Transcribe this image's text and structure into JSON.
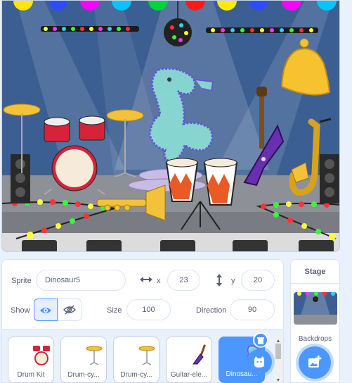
{
  "sprite_info": {
    "sprite_label": "Sprite",
    "sprite_name": "Dinosaur5",
    "x_label": "x",
    "x_value": "23",
    "y_label": "y",
    "y_value": "20",
    "show_label": "Show",
    "size_label": "Size",
    "size_value": "100",
    "direction_label": "Direction",
    "direction_value": "90"
  },
  "sprites": [
    {
      "name": "Drum Kit",
      "icon": "drum-kit-icon"
    },
    {
      "name": "Drum-cy...",
      "icon": "cymbal-icon"
    },
    {
      "name": "Drum-cy...",
      "icon": "cymbal-icon"
    },
    {
      "name": "Guitar-ele...",
      "icon": "electric-guitar-icon"
    },
    {
      "name": "Dinosau...",
      "icon": "dinosaur-icon",
      "selected": true
    }
  ],
  "stage_panel": {
    "title": "Stage",
    "backdrops_label": "Backdrops"
  },
  "colors": {
    "accent": "#4c97ff",
    "stage_blue": "#3c5f93",
    "panel_text": "#575e75",
    "delete_badge": "#4c97ff"
  }
}
